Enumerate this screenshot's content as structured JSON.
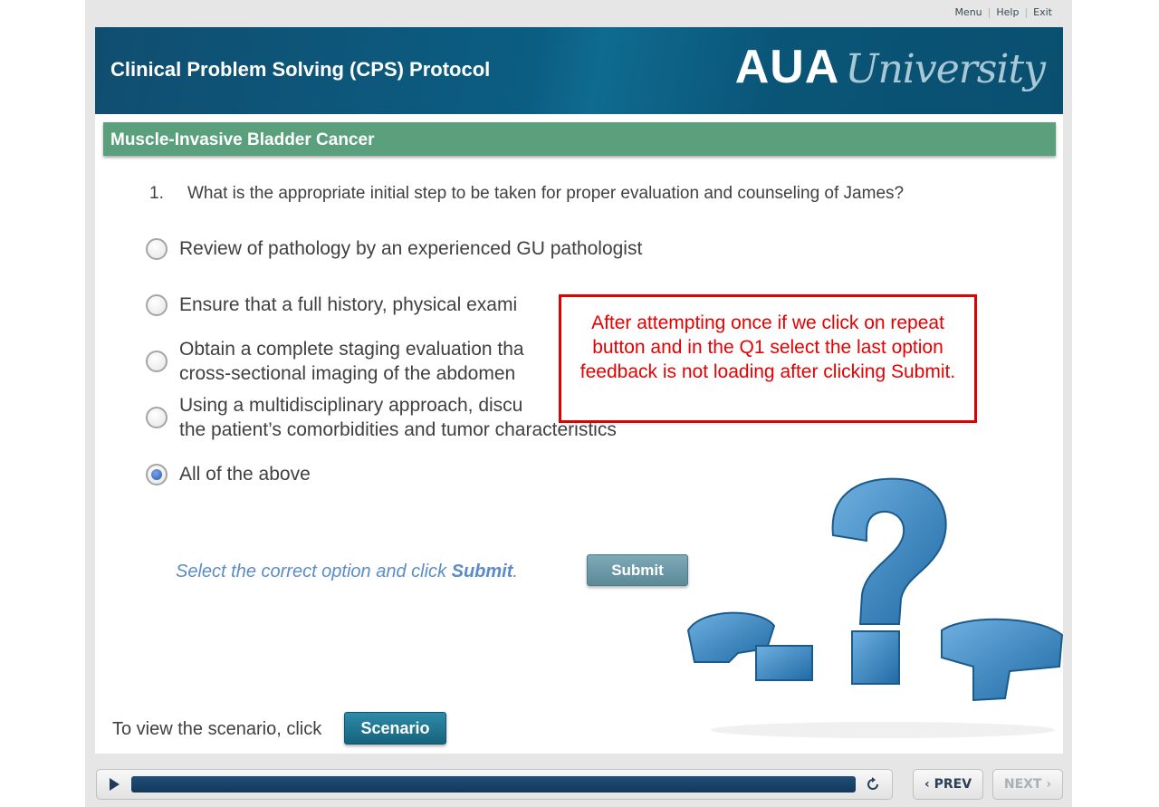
{
  "topnav": {
    "menu": "Menu",
    "help": "Help",
    "exit": "Exit"
  },
  "header": {
    "title": "Clinical Problem Solving (CPS) Protocol",
    "logo_aua": "AUA",
    "logo_university": "University"
  },
  "banner": {
    "title": "Muscle-Invasive Bladder Cancer"
  },
  "question": {
    "number": "1.",
    "text": "What is the appropriate initial step to be taken for proper evaluation and counseling of James?",
    "options": [
      {
        "line1": "Review of pathology by an experienced GU pathologist",
        "line2": "",
        "selected": false
      },
      {
        "line1": "Ensure that a full history, physical exami",
        "line2": "",
        "selected": false
      },
      {
        "line1": "Obtain a complete staging evaluation tha",
        "line2": "cross-sectional imaging of the abdomen",
        "selected": false
      },
      {
        "line1": "Using a multidisciplinary approach, discu",
        "line2": "the patient’s comorbidities and tumor characteristics",
        "selected": false
      },
      {
        "line1": "All of the above",
        "line2": "",
        "selected": true
      }
    ]
  },
  "instruction": {
    "prefix": "Select the correct option and click ",
    "bold": "Submit",
    "suffix": "."
  },
  "submit_label": "Submit",
  "scenario": {
    "label": "To view the scenario, click",
    "button": "Scenario"
  },
  "callout": {
    "text": "After attempting once if we click on repeat button and in the Q1 select the last option feedback is not loading after clicking Submit."
  },
  "playbar": {
    "progress": 1.0
  },
  "nav": {
    "prev": "PREV",
    "next": "NEXT"
  },
  "colors": {
    "header": "#0b5d82",
    "banner": "#5ba07c",
    "instruction": "#5b8cc6",
    "callout": "#e00000",
    "progress": "#1f4f7b"
  }
}
